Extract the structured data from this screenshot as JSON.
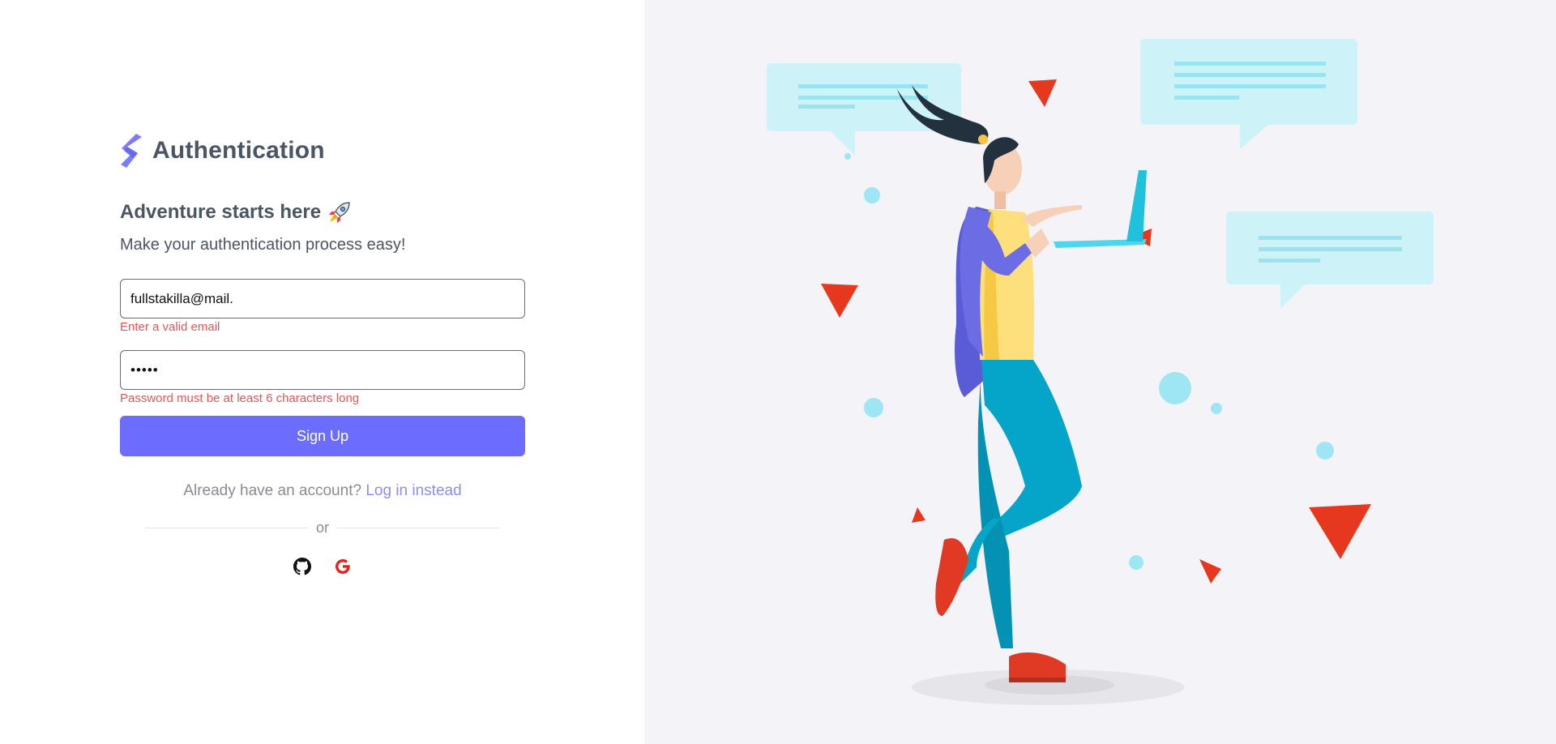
{
  "brand": {
    "name": "Authentication",
    "logo_color": "#7c7cff"
  },
  "intro": {
    "heading": "Adventure starts here",
    "heading_icon": "rocket-icon",
    "subheading": "Make your authentication process easy!"
  },
  "form": {
    "email": {
      "value": "fullstakilla@mail.",
      "error": "Enter a valid email"
    },
    "password": {
      "value": "•••••",
      "error": "Password must be at least 6 characters long"
    },
    "submit_label": "Sign Up"
  },
  "switch": {
    "prompt": "Already have an account?",
    "link_label": "Log in instead"
  },
  "divider": {
    "text": "or"
  },
  "social": {
    "github_icon": "github-icon",
    "google_icon": "google-icon"
  },
  "colors": {
    "accent": "#6c6cff",
    "error": "#ea5455",
    "link": "#8d8df0",
    "right_panel_bg": "#f4f3f8"
  }
}
